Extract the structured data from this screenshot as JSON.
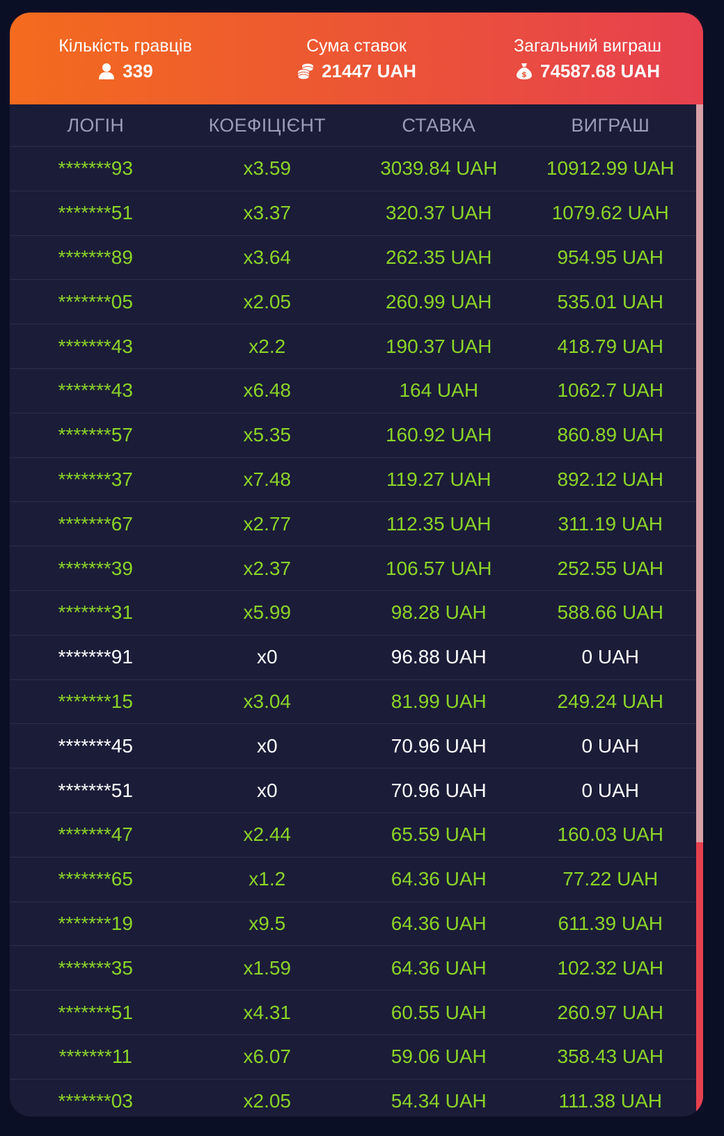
{
  "stats": {
    "players": {
      "label": "Кількість гравців",
      "value": "339",
      "icon": "person-icon"
    },
    "bets": {
      "label": "Сума ставок",
      "value": "21447 UAH",
      "icon": "coins-icon"
    },
    "winnings": {
      "label": "Загальний виграш",
      "value": "74587.68 UAH",
      "icon": "money-bag-icon"
    }
  },
  "colors": {
    "win_text": "#8bd428",
    "lost_text": "#ffffff",
    "header_start": "#f46b1e",
    "header_end": "#e6404f",
    "panel_bg": "#1b1c38",
    "page_bg": "#0b0f26"
  },
  "table": {
    "headers": [
      "ЛОГІН",
      "КОЕФІЦІЄНТ",
      "СТАВКА",
      "ВИГРАШ"
    ],
    "rows": [
      {
        "login": "*******93",
        "coef": "x3.59",
        "bet": "3039.84 UAH",
        "win": "10912.99 UAH",
        "status": "won"
      },
      {
        "login": "*******51",
        "coef": "x3.37",
        "bet": "320.37 UAH",
        "win": "1079.62 UAH",
        "status": "won"
      },
      {
        "login": "*******89",
        "coef": "x3.64",
        "bet": "262.35 UAH",
        "win": "954.95 UAH",
        "status": "won"
      },
      {
        "login": "*******05",
        "coef": "x2.05",
        "bet": "260.99 UAH",
        "win": "535.01 UAH",
        "status": "won"
      },
      {
        "login": "*******43",
        "coef": "x2.2",
        "bet": "190.37 UAH",
        "win": "418.79 UAH",
        "status": "won"
      },
      {
        "login": "*******43",
        "coef": "x6.48",
        "bet": "164 UAH",
        "win": "1062.7 UAH",
        "status": "won"
      },
      {
        "login": "*******57",
        "coef": "x5.35",
        "bet": "160.92 UAH",
        "win": "860.89 UAH",
        "status": "won"
      },
      {
        "login": "*******37",
        "coef": "x7.48",
        "bet": "119.27 UAH",
        "win": "892.12 UAH",
        "status": "won"
      },
      {
        "login": "*******67",
        "coef": "x2.77",
        "bet": "112.35 UAH",
        "win": "311.19 UAH",
        "status": "won"
      },
      {
        "login": "*******39",
        "coef": "x2.37",
        "bet": "106.57 UAH",
        "win": "252.55 UAH",
        "status": "won"
      },
      {
        "login": "*******31",
        "coef": "x5.99",
        "bet": "98.28 UAH",
        "win": "588.66 UAH",
        "status": "won"
      },
      {
        "login": "*******91",
        "coef": "x0",
        "bet": "96.88 UAH",
        "win": "0 UAH",
        "status": "lost"
      },
      {
        "login": "*******15",
        "coef": "x3.04",
        "bet": "81.99 UAH",
        "win": "249.24 UAH",
        "status": "won"
      },
      {
        "login": "*******45",
        "coef": "x0",
        "bet": "70.96 UAH",
        "win": "0 UAH",
        "status": "lost"
      },
      {
        "login": "*******51",
        "coef": "x0",
        "bet": "70.96 UAH",
        "win": "0 UAH",
        "status": "lost"
      },
      {
        "login": "*******47",
        "coef": "x2.44",
        "bet": "65.59 UAH",
        "win": "160.03 UAH",
        "status": "won"
      },
      {
        "login": "*******65",
        "coef": "x1.2",
        "bet": "64.36 UAH",
        "win": "77.22 UAH",
        "status": "won"
      },
      {
        "login": "*******19",
        "coef": "x9.5",
        "bet": "64.36 UAH",
        "win": "611.39 UAH",
        "status": "won"
      },
      {
        "login": "*******35",
        "coef": "x1.59",
        "bet": "64.36 UAH",
        "win": "102.32 UAH",
        "status": "won"
      },
      {
        "login": "*******51",
        "coef": "x4.31",
        "bet": "60.55 UAH",
        "win": "260.97 UAH",
        "status": "won"
      },
      {
        "login": "*******11",
        "coef": "x6.07",
        "bet": "59.06 UAH",
        "win": "358.43 UAH",
        "status": "won"
      },
      {
        "login": "*******03",
        "coef": "x2.05",
        "bet": "54.34 UAH",
        "win": "111.38 UAH",
        "status": "won"
      }
    ]
  }
}
